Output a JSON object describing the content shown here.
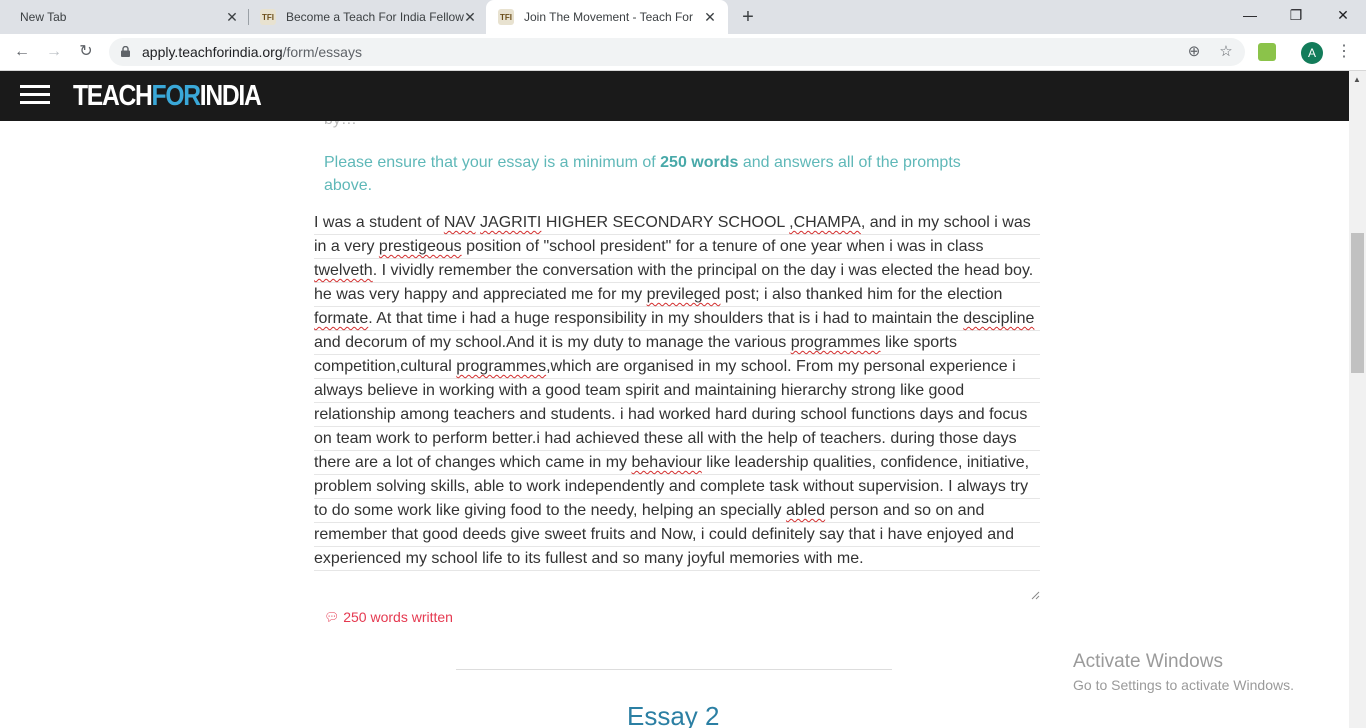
{
  "browser": {
    "tabs": [
      {
        "title": "New Tab",
        "active": false,
        "has_favicon": false
      },
      {
        "title": "Become a Teach For India Fellow",
        "active": false,
        "has_favicon": true
      },
      {
        "title": "Join The Movement - Teach For I",
        "active": true,
        "has_favicon": true
      }
    ],
    "new_tab_icon": "plus-icon",
    "window_controls": {
      "minimize": "—",
      "restore": "❐",
      "close": "✕"
    },
    "url_host": "apply.teachforindia.org",
    "url_path": "/form/essays",
    "avatar_letter": "A"
  },
  "header": {
    "logo_teach": "TEACH",
    "logo_for": "FOR",
    "logo_india": "INDIA"
  },
  "form": {
    "cutoff_text": "by…",
    "notice_pre": "Please ensure that your essay is a minimum of ",
    "notice_strong": "250 words",
    "notice_post": " and answers all of the prompts above.",
    "word_count": "250 words written",
    "next_section_title": "Essay 2"
  },
  "essay": {
    "segments": [
      {
        "t": "I was a student of "
      },
      {
        "t": "NAV",
        "sp": true
      },
      {
        "t": " "
      },
      {
        "t": "JAGRITI",
        "sp": true
      },
      {
        "t": " HIGHER SECONDARY SCHOOL "
      },
      {
        "t": ",CHAMPA",
        "sp": true
      },
      {
        "t": ", and in my school i was in a very "
      },
      {
        "t": "prestigeous",
        "sp": true
      },
      {
        "t": " position of \"school president\" for a tenure of one year when i was in class "
      },
      {
        "t": "twelveth",
        "sp": true
      },
      {
        "t": ". I vividly remember the conversation with the principal on the day i was elected the head boy. he was very happy and appreciated me for my "
      },
      {
        "t": "previleged",
        "sp": true
      },
      {
        "t": " post; i also thanked him for the election "
      },
      {
        "t": "formate",
        "sp": true
      },
      {
        "t": ". At that time i had a huge responsibility in my shoulders that is i had to maintain the "
      },
      {
        "t": "descipline",
        "sp": true
      },
      {
        "t": " and decorum of my school.And it is my duty to manage the various "
      },
      {
        "t": "programmes",
        "sp": true
      },
      {
        "t": "  like sports competition,cultural "
      },
      {
        "t": "programmes",
        "sp": true
      },
      {
        "t": ",which are organised in my school. From my personal experience i always believe in working with a good team spirit and maintaining hierarchy strong like good relationship among teachers and students. i had worked hard during school functions days and focus on team work to perform better.i had achieved these all with the help of teachers. during those days there are a lot of changes which came in my "
      },
      {
        "t": "behaviour",
        "sp": true
      },
      {
        "t": " like leadership qualities, confidence, initiative, problem solving skills, able to work independently and complete task without supervision. I always try to do some work like giving food to the needy, helping an specially "
      },
      {
        "t": "abled",
        "sp": true
      },
      {
        "t": " person and so on and remember that good deeds give sweet fruits and Now, i could definitely say that i have enjoyed and experienced my school life to its fullest and so many joyful memories with me."
      }
    ]
  },
  "watermark": {
    "line1": "Activate Windows",
    "line2": "Go to Settings to activate Windows."
  }
}
